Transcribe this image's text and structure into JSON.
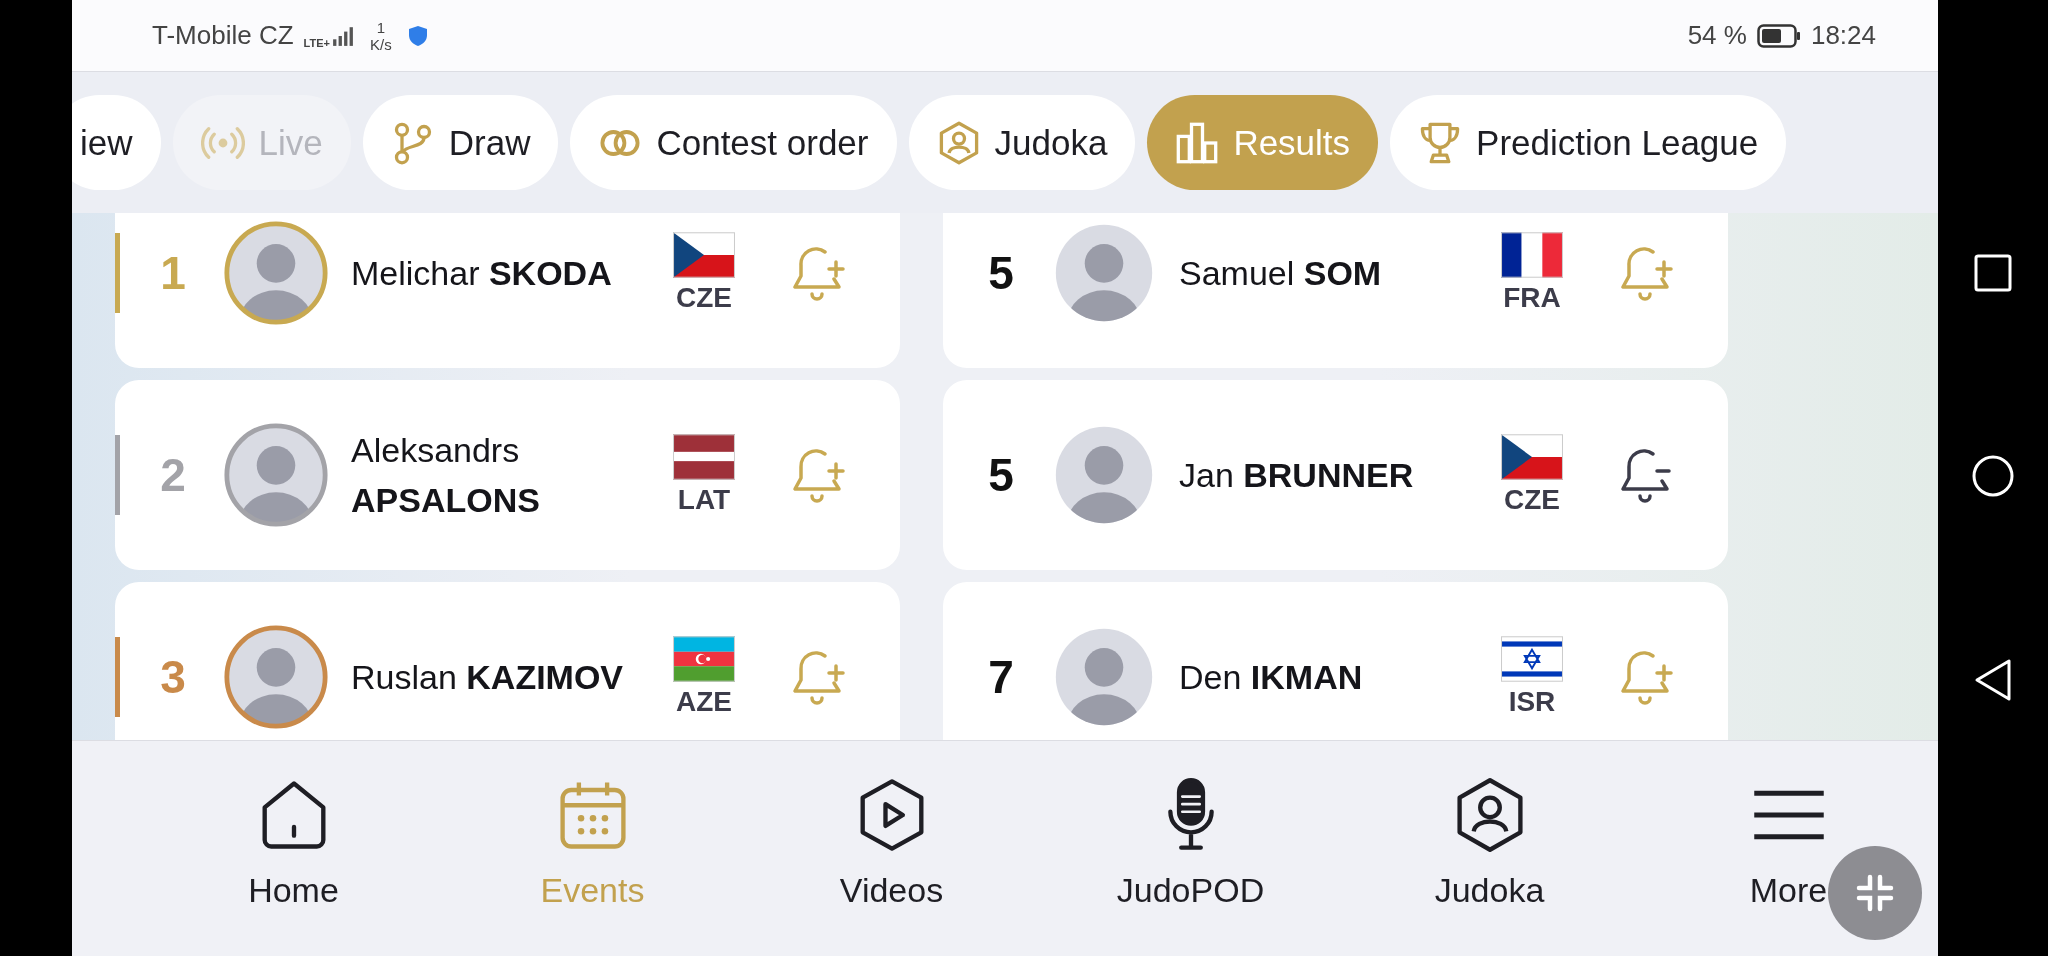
{
  "status_bar": {
    "carrier": "T-Mobile CZ",
    "network": "LTE+",
    "speed_value": "1",
    "speed_unit": "K/s",
    "battery": "54 %",
    "time": "18:24"
  },
  "tabs": [
    {
      "label": "iew",
      "kind": "plain",
      "selected": false,
      "disabled": false
    },
    {
      "label": "Live",
      "kind": "live",
      "selected": false,
      "disabled": true
    },
    {
      "label": "Draw",
      "kind": "branch",
      "selected": false,
      "disabled": false
    },
    {
      "label": "Contest order",
      "kind": "rings",
      "selected": false,
      "disabled": false
    },
    {
      "label": "Judoka",
      "kind": "person",
      "selected": false,
      "disabled": false
    },
    {
      "label": "Results",
      "kind": "bars",
      "selected": true,
      "disabled": false
    },
    {
      "label": "Prediction League",
      "kind": "trophy",
      "selected": false,
      "disabled": false
    }
  ],
  "results": [
    {
      "rank": "1",
      "kind": "gold",
      "name": "Melichar **SKODA**",
      "flag": {
        "kind": "cz"
      },
      "country": "CZE",
      "following": false
    },
    {
      "rank": "5",
      "kind": "plain",
      "name": "Samuel **SOM**",
      "flag": {
        "kind": "fr"
      },
      "country": "FRA",
      "following": false
    },
    {
      "rank": "2",
      "kind": "silver",
      "name": "Aleksandrs **APSALONS**",
      "flag": {
        "kind": "lv"
      },
      "country": "LAT",
      "following": false
    },
    {
      "rank": "5",
      "kind": "plain",
      "name": "Jan **BRUNNER**",
      "flag": {
        "kind": "cz"
      },
      "country": "CZE",
      "following": true
    },
    {
      "rank": "3",
      "kind": "bronze",
      "name": "Ruslan **KAZIMOV**",
      "flag": {
        "kind": "az"
      },
      "country": "AZE",
      "following": false
    },
    {
      "rank": "7",
      "kind": "plain",
      "name": "Den **IKMAN**",
      "flag": {
        "kind": "il"
      },
      "country": "ISR",
      "following": false
    }
  ],
  "bottom_nav": [
    {
      "label": "Home",
      "kind": "home",
      "selected": false
    },
    {
      "label": "Events",
      "kind": "calendar",
      "selected": true
    },
    {
      "label": "Videos",
      "kind": "play",
      "selected": false
    },
    {
      "label": "JudoPOD",
      "kind": "mic",
      "selected": false
    },
    {
      "label": "Judoka",
      "kind": "person",
      "selected": false
    },
    {
      "label": "More",
      "kind": "menu",
      "selected": false
    }
  ]
}
